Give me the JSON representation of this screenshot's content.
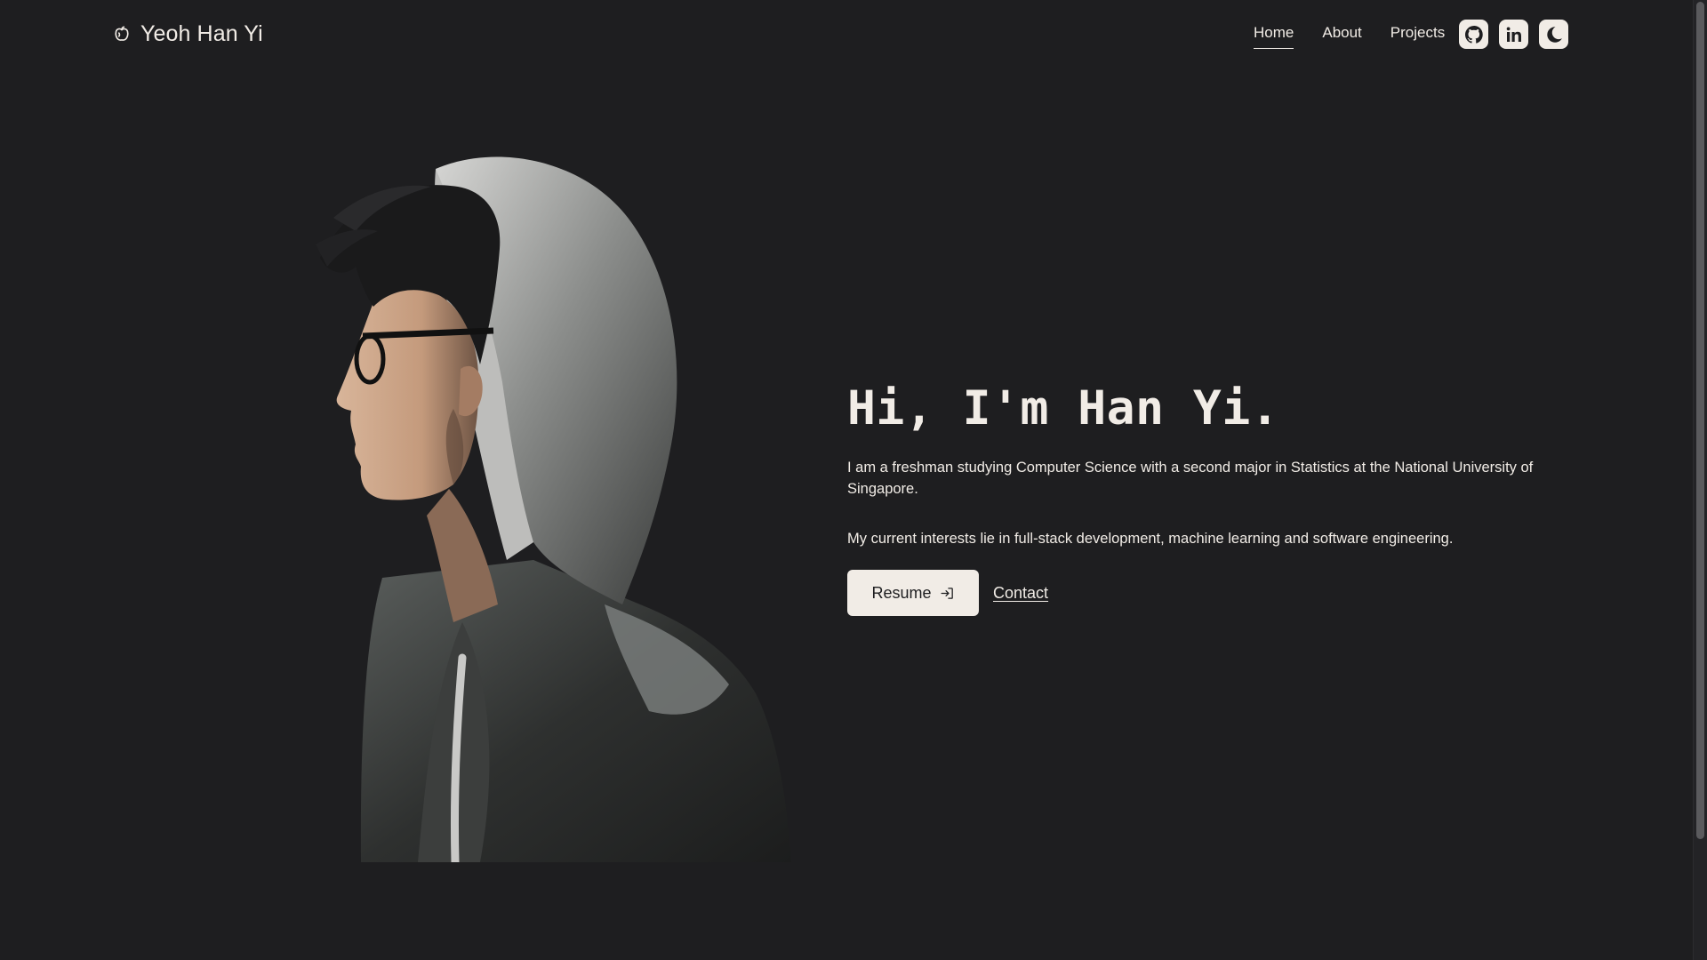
{
  "header": {
    "brand_name": "Yeoh Han Yi",
    "brand_icon": "apple-core-icon",
    "nav": [
      {
        "label": "Home",
        "active": true
      },
      {
        "label": "About",
        "active": false
      },
      {
        "label": "Projects",
        "active": false
      }
    ],
    "icon_buttons": [
      "github-icon",
      "linkedin-icon",
      "moon-icon"
    ]
  },
  "hero": {
    "title": "Hi, I'm Han Yi.",
    "paragraph_1": "I am a freshman studying Computer Science with a second major in Statistics at the National University of Singapore.",
    "paragraph_2": "My current interests lie in full-stack development, machine learning and software engineering.",
    "resume_label": "Resume",
    "contact_label": "Contact"
  },
  "colors": {
    "background": "#1e1e20",
    "foreground": "#f1ece6",
    "button_bg": "#f1ece6",
    "button_text": "#1e1e20"
  }
}
